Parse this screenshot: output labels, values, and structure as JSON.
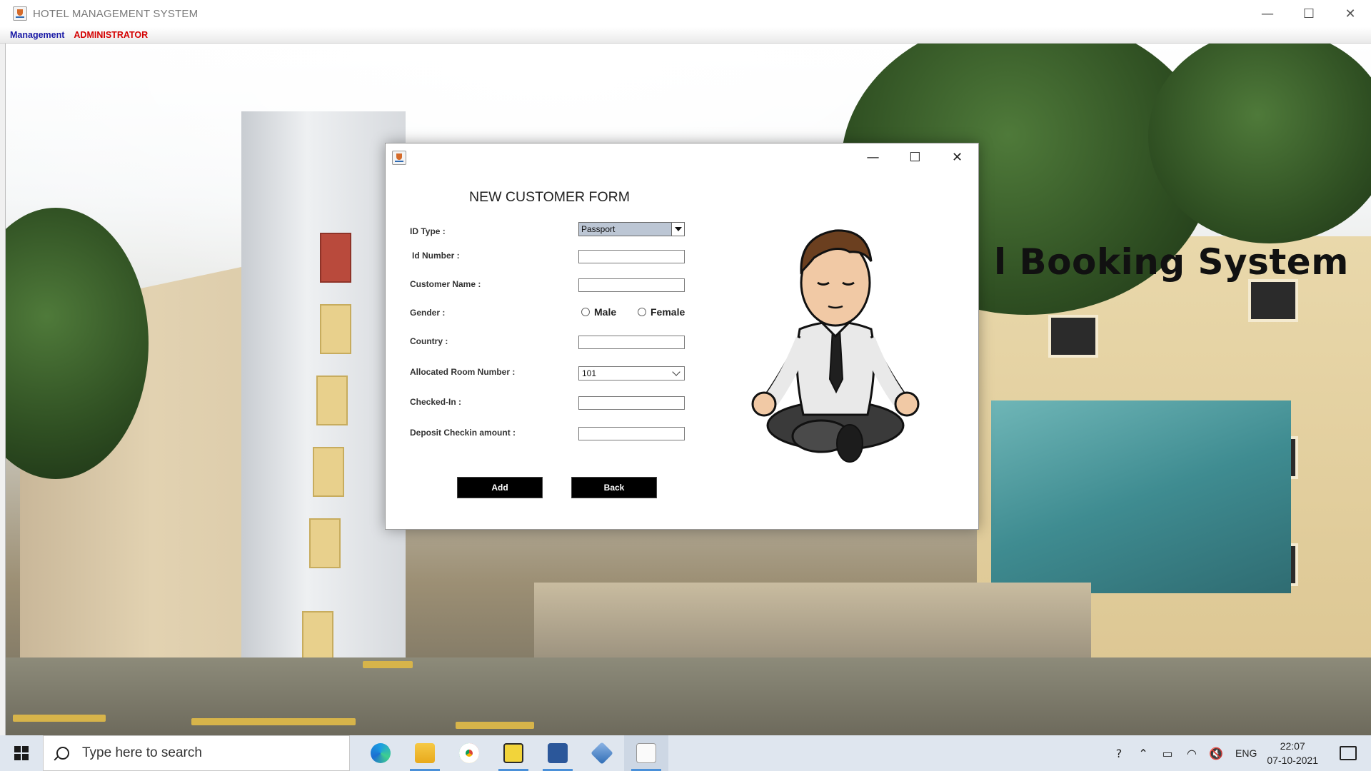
{
  "main_window": {
    "title": "HOTEL MANAGEMENT SYSTEM",
    "controls": {
      "minimize": "—",
      "maximize": "☐",
      "close": "✕"
    }
  },
  "menubar": {
    "management": "Management",
    "administrator": "ADMINISTRATOR"
  },
  "background": {
    "heading": "l Booking System"
  },
  "dialog": {
    "controls": {
      "minimize": "—",
      "maximize": "☐",
      "close": "✕"
    },
    "form_title": "NEW CUSTOMER FORM",
    "labels": {
      "id_type": "ID Type :",
      "id_number": "Id Number :",
      "customer_name": "Customer Name :",
      "gender": "Gender :",
      "country": "Country :",
      "room": "Allocated Room Number :",
      "checked_in": "Checked-In :",
      "deposit": "Deposit Checkin amount :"
    },
    "id_type_selected": "Passport",
    "room_selected": "101",
    "fields": {
      "id_number": "",
      "customer_name": "",
      "country": "",
      "checked_in": "",
      "deposit": ""
    },
    "gender_options": {
      "male": "Male",
      "female": "Female"
    },
    "buttons": {
      "add": "Add",
      "back": "Back"
    }
  },
  "taskbar": {
    "search_placeholder": "Type here to search",
    "apps": [
      "edge-icon",
      "file-explorer-icon",
      "chrome-icon",
      "pdf-icon",
      "word-icon",
      "virtualbox-icon",
      "java-icon"
    ],
    "tray": {
      "language": "ENG",
      "time": "22:07",
      "date": "07-10-2021"
    }
  },
  "colors": {
    "menu_blue": "#1a1aa6",
    "menu_red": "#d40000",
    "button_black": "#000000",
    "select_bg": "#bcc6d4",
    "taskbar": "#dfe6ef"
  }
}
